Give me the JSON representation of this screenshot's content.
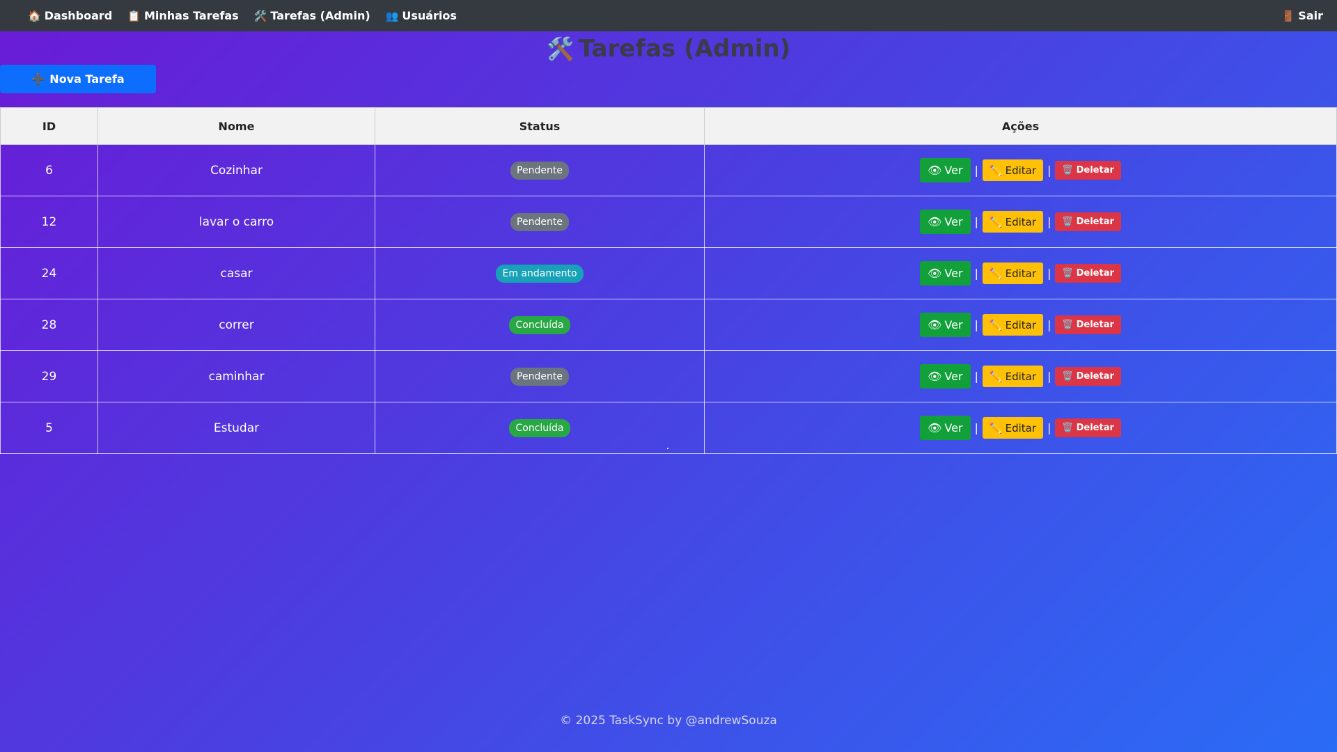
{
  "nav": {
    "items": [
      {
        "icon": "house-icon",
        "glyph": "🏠",
        "label": "Dashboard"
      },
      {
        "icon": "clipboard-icon",
        "glyph": "📋",
        "label": "Minhas Tarefas"
      },
      {
        "icon": "tools-icon",
        "glyph": "🛠️",
        "label": "Tarefas (Admin)"
      },
      {
        "icon": "users-icon",
        "glyph": "👥",
        "label": "Usuários"
      }
    ],
    "logout": {
      "icon": "door-icon",
      "glyph": "🚪",
      "label": "Sair"
    }
  },
  "page": {
    "title_icon": "🛠️",
    "title": "Tarefas (Admin)"
  },
  "new_task": {
    "icon": "plus-icon",
    "glyph": "➕",
    "label": "Nova Tarefa"
  },
  "table": {
    "headers": {
      "id": "ID",
      "name": "Nome",
      "status": "Status",
      "actions": "Ações"
    },
    "rows": [
      {
        "id": "6",
        "name": "Cozinhar",
        "status": "Pendente",
        "status_color": "#6c757d"
      },
      {
        "id": "12",
        "name": "lavar o carro",
        "status": "Pendente",
        "status_color": "#6c757d"
      },
      {
        "id": "24",
        "name": "casar",
        "status": "Em andamento",
        "status_color": "#17a2b8"
      },
      {
        "id": "28",
        "name": "correr",
        "status": "Concluída",
        "status_color": "#28a745"
      },
      {
        "id": "29",
        "name": "caminhar",
        "status": "Pendente",
        "status_color": "#6c757d"
      },
      {
        "id": "5",
        "name": "Estudar",
        "status": "Concluída",
        "status_color": "#28a745"
      }
    ],
    "actions": {
      "view": {
        "glyph": "👁",
        "label": "Ver"
      },
      "edit": {
        "glyph": "✏️",
        "label": "Editar"
      },
      "delete": {
        "glyph": "🗑️",
        "label": "Deletar"
      },
      "separator": "|"
    }
  },
  "footer": {
    "text": "© 2025 TaskSync by @andrewSouza"
  },
  "colors": {
    "navbar": "#343a40",
    "primary": "#0d6efd",
    "view": "#12a03a",
    "edit": "#ffc107",
    "delete": "#dc3545"
  }
}
